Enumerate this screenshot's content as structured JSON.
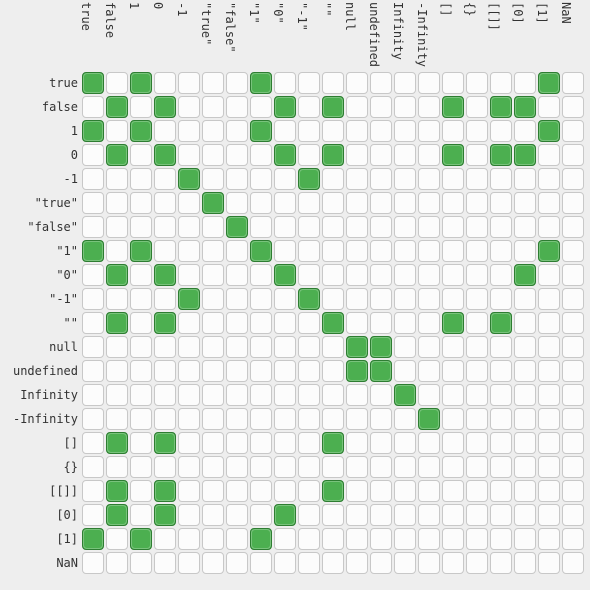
{
  "chart_data": {
    "type": "heatmap",
    "title": "",
    "xlabel": "",
    "ylabel": "",
    "categories": [
      "true",
      "false",
      "1",
      "0",
      "-1",
      "\"true\"",
      "\"false\"",
      "\"1\"",
      "\"0\"",
      "\"-1\"",
      "\"\"",
      "null",
      "undefined",
      "Infinity",
      "-Infinity",
      "[]",
      "{}",
      "[[]]",
      "[0]",
      "[1]",
      "NaN"
    ],
    "matrix": [
      [
        1,
        0,
        1,
        0,
        0,
        0,
        0,
        1,
        0,
        0,
        0,
        0,
        0,
        0,
        0,
        0,
        0,
        0,
        0,
        1,
        0
      ],
      [
        0,
        1,
        0,
        1,
        0,
        0,
        0,
        0,
        1,
        0,
        1,
        0,
        0,
        0,
        0,
        1,
        0,
        1,
        1,
        0,
        0
      ],
      [
        1,
        0,
        1,
        0,
        0,
        0,
        0,
        1,
        0,
        0,
        0,
        0,
        0,
        0,
        0,
        0,
        0,
        0,
        0,
        1,
        0
      ],
      [
        0,
        1,
        0,
        1,
        0,
        0,
        0,
        0,
        1,
        0,
        1,
        0,
        0,
        0,
        0,
        1,
        0,
        1,
        1,
        0,
        0
      ],
      [
        0,
        0,
        0,
        0,
        1,
        0,
        0,
        0,
        0,
        1,
        0,
        0,
        0,
        0,
        0,
        0,
        0,
        0,
        0,
        0,
        0
      ],
      [
        0,
        0,
        0,
        0,
        0,
        1,
        0,
        0,
        0,
        0,
        0,
        0,
        0,
        0,
        0,
        0,
        0,
        0,
        0,
        0,
        0
      ],
      [
        0,
        0,
        0,
        0,
        0,
        0,
        1,
        0,
        0,
        0,
        0,
        0,
        0,
        0,
        0,
        0,
        0,
        0,
        0,
        0,
        0
      ],
      [
        1,
        0,
        1,
        0,
        0,
        0,
        0,
        1,
        0,
        0,
        0,
        0,
        0,
        0,
        0,
        0,
        0,
        0,
        0,
        1,
        0
      ],
      [
        0,
        1,
        0,
        1,
        0,
        0,
        0,
        0,
        1,
        0,
        0,
        0,
        0,
        0,
        0,
        0,
        0,
        0,
        1,
        0,
        0
      ],
      [
        0,
        0,
        0,
        0,
        1,
        0,
        0,
        0,
        0,
        1,
        0,
        0,
        0,
        0,
        0,
        0,
        0,
        0,
        0,
        0,
        0
      ],
      [
        0,
        1,
        0,
        1,
        0,
        0,
        0,
        0,
        0,
        0,
        1,
        0,
        0,
        0,
        0,
        1,
        0,
        1,
        0,
        0,
        0
      ],
      [
        0,
        0,
        0,
        0,
        0,
        0,
        0,
        0,
        0,
        0,
        0,
        1,
        1,
        0,
        0,
        0,
        0,
        0,
        0,
        0,
        0
      ],
      [
        0,
        0,
        0,
        0,
        0,
        0,
        0,
        0,
        0,
        0,
        0,
        1,
        1,
        0,
        0,
        0,
        0,
        0,
        0,
        0,
        0
      ],
      [
        0,
        0,
        0,
        0,
        0,
        0,
        0,
        0,
        0,
        0,
        0,
        0,
        0,
        1,
        0,
        0,
        0,
        0,
        0,
        0,
        0
      ],
      [
        0,
        0,
        0,
        0,
        0,
        0,
        0,
        0,
        0,
        0,
        0,
        0,
        0,
        0,
        1,
        0,
        0,
        0,
        0,
        0,
        0
      ],
      [
        0,
        1,
        0,
        1,
        0,
        0,
        0,
        0,
        0,
        0,
        1,
        0,
        0,
        0,
        0,
        0,
        0,
        0,
        0,
        0,
        0
      ],
      [
        0,
        0,
        0,
        0,
        0,
        0,
        0,
        0,
        0,
        0,
        0,
        0,
        0,
        0,
        0,
        0,
        0,
        0,
        0,
        0,
        0
      ],
      [
        0,
        1,
        0,
        1,
        0,
        0,
        0,
        0,
        0,
        0,
        1,
        0,
        0,
        0,
        0,
        0,
        0,
        0,
        0,
        0,
        0
      ],
      [
        0,
        1,
        0,
        1,
        0,
        0,
        0,
        0,
        1,
        0,
        0,
        0,
        0,
        0,
        0,
        0,
        0,
        0,
        0,
        0,
        0
      ],
      [
        1,
        0,
        1,
        0,
        0,
        0,
        0,
        1,
        0,
        0,
        0,
        0,
        0,
        0,
        0,
        0,
        0,
        0,
        0,
        0,
        0
      ],
      [
        0,
        0,
        0,
        0,
        0,
        0,
        0,
        0,
        0,
        0,
        0,
        0,
        0,
        0,
        0,
        0,
        0,
        0,
        0,
        0,
        0
      ]
    ],
    "legend": {
      "true_color": "#4caf50",
      "false_color": "#fcfcfc"
    }
  }
}
